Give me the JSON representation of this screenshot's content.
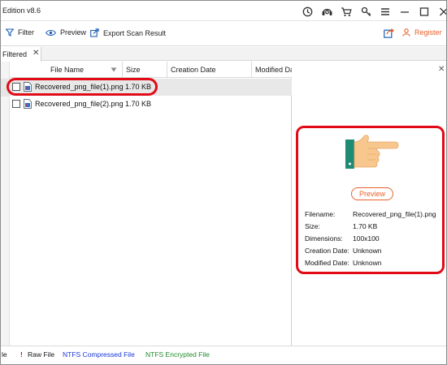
{
  "window": {
    "title": "Edition v8.6"
  },
  "toolbar": {
    "filter_label": "Filter",
    "preview_label": "Preview",
    "export_label": "Export Scan Result",
    "register_label": "Register"
  },
  "tabs": [
    {
      "label": "Filtered"
    }
  ],
  "table": {
    "columns": [
      "File Name",
      "Size",
      "Creation Date",
      "Modified Da"
    ],
    "rows": [
      {
        "name": "Recovered_png_file(1).png",
        "size": "1.70 KB",
        "selected": true,
        "checked": false
      },
      {
        "name": "Recovered_png_file(2).png",
        "size": "1.70 KB",
        "selected": false,
        "checked": false
      }
    ]
  },
  "preview": {
    "button_label": "Preview",
    "fields": [
      {
        "label": "Filename:",
        "value": "Recovered_png_file(1).png"
      },
      {
        "label": "Size:",
        "value": "1.70 KB"
      },
      {
        "label": "Dimensions:",
        "value": "100x100"
      },
      {
        "label": "Creation Date:",
        "value": "Unknown"
      },
      {
        "label": "Modified Date:",
        "value": "Unknown"
      }
    ]
  },
  "status_legend": {
    "left_fragment": "le",
    "raw_marker": "!",
    "raw_label": "Raw File",
    "compressed_label": "NTFS Compressed File",
    "encrypted_label": "NTFS Encrypted File"
  },
  "colors": {
    "accent": "#e8612c",
    "highlight_red": "#e10b17",
    "compressed_blue": "#1a35d8",
    "encrypted_green": "#1f8a2a"
  },
  "icons": {
    "titlebar": [
      "clock-icon",
      "support-icon",
      "cart-icon",
      "key-icon",
      "menu-icon",
      "minimize-icon",
      "maximize-icon",
      "close-icon"
    ],
    "toolbar": [
      "filter-icon",
      "eye-icon",
      "export-icon",
      "share-icon"
    ]
  }
}
